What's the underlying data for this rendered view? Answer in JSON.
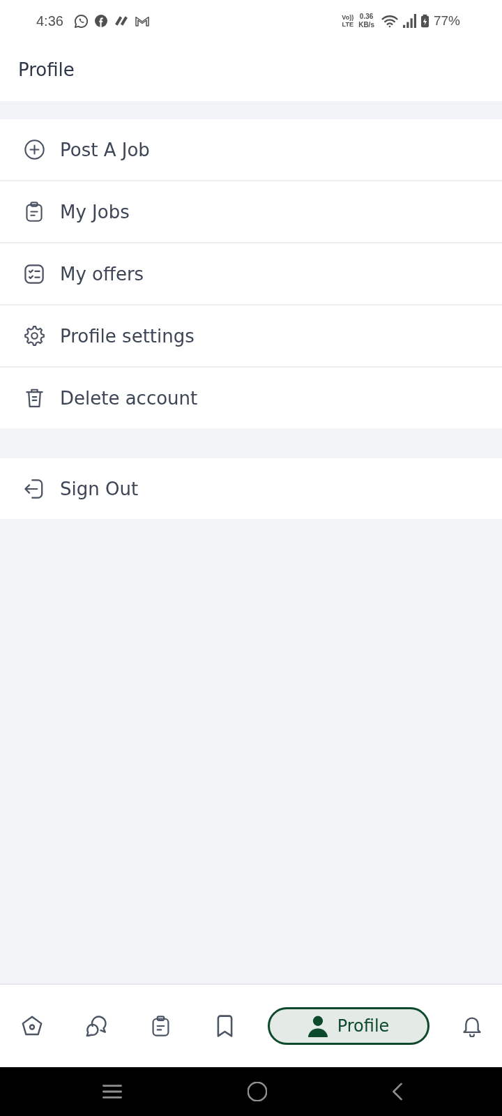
{
  "status_bar": {
    "time": "4:36",
    "network_label": [
      "Vo))",
      "LTE"
    ],
    "data_speed": [
      "0.36",
      "KB/s"
    ],
    "battery": "77%"
  },
  "header": {
    "title": "Profile"
  },
  "menu_groups": [
    {
      "items": [
        {
          "label": "Post A Job"
        },
        {
          "label": "My Jobs"
        },
        {
          "label": "My offers"
        },
        {
          "label": "Profile settings"
        },
        {
          "label": "Delete account"
        }
      ]
    },
    {
      "items": [
        {
          "label": "Sign Out"
        }
      ]
    }
  ],
  "bottom_nav": {
    "tabs": [
      {
        "selected": false
      },
      {
        "selected": false
      },
      {
        "selected": false
      },
      {
        "selected": false
      },
      {
        "label": "Profile",
        "selected": true
      },
      {
        "selected": false
      }
    ]
  }
}
